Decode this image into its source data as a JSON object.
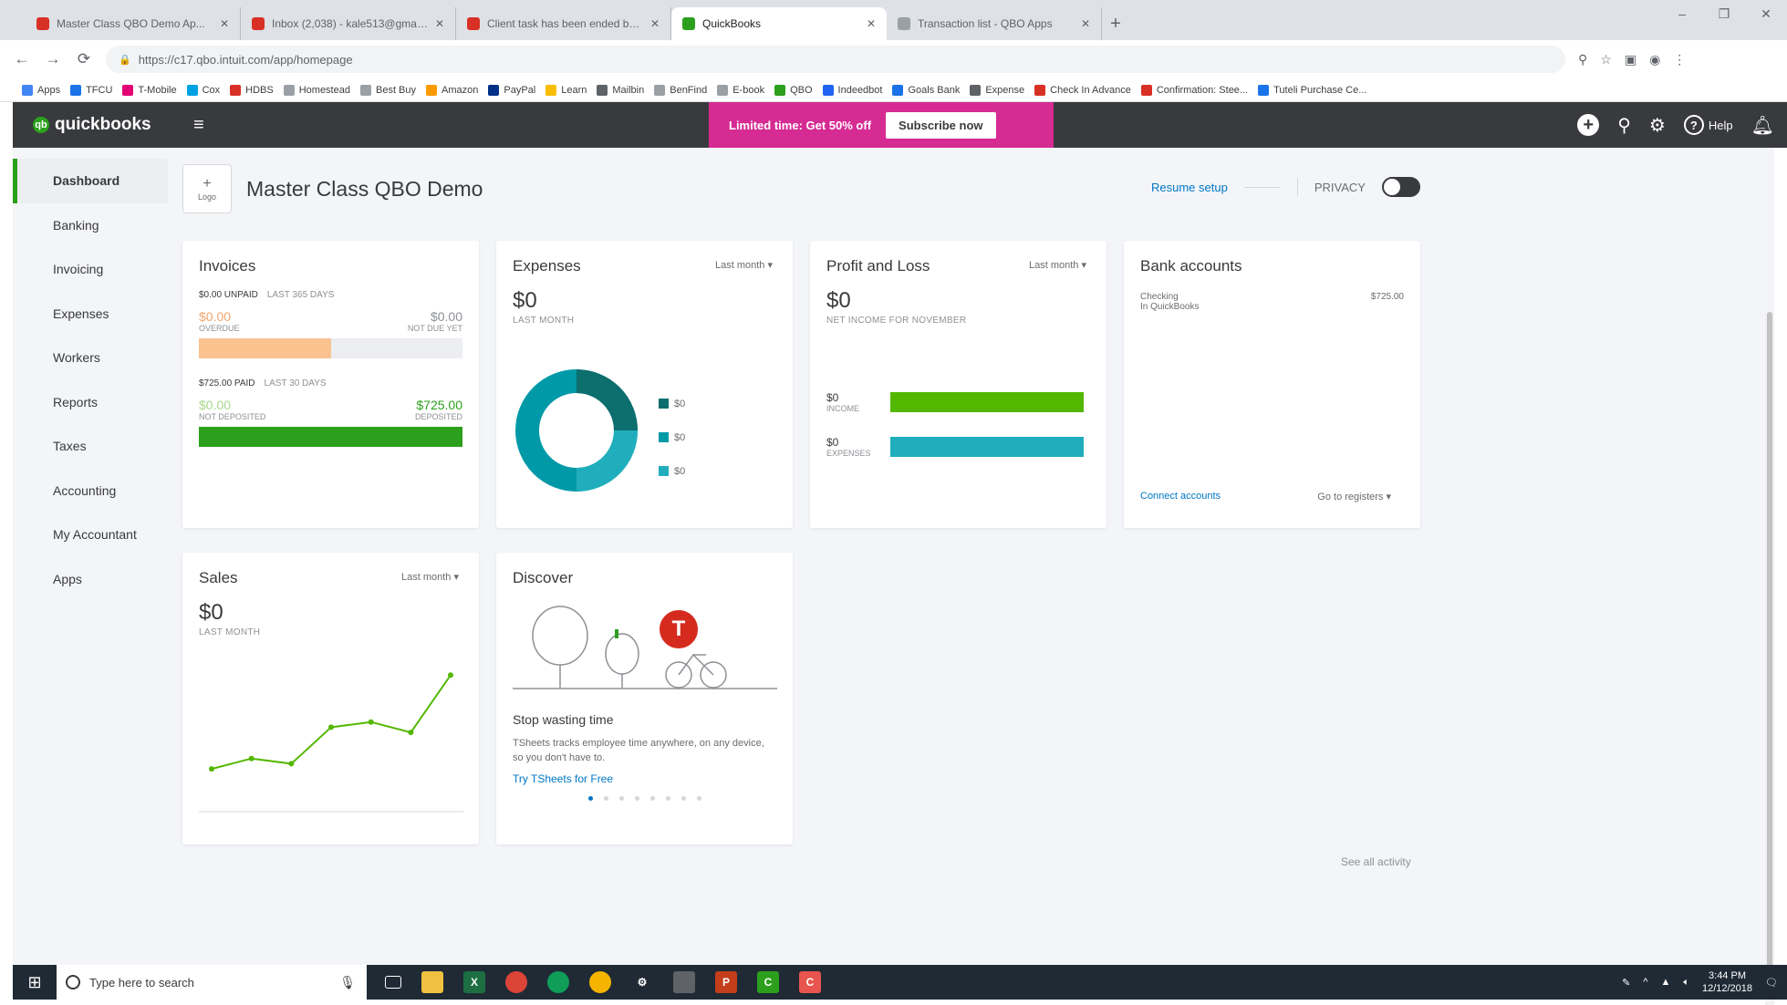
{
  "browser": {
    "tabs": [
      {
        "title": "Master Class QBO Demo Ap...",
        "icon": "gmail-icon",
        "color": "#d93025",
        "active": false
      },
      {
        "title": "Inbox (2,038) - kale513@gmail...",
        "icon": "gmail-icon",
        "color": "#d93025",
        "active": false
      },
      {
        "title": "Client task has been ended by ...",
        "icon": "gmail-icon",
        "color": "#d93025",
        "active": false
      },
      {
        "title": "QuickBooks",
        "icon": "quickbooks-icon",
        "color": "#2ca01c",
        "active": true
      },
      {
        "title": "Transaction list - QBO Apps",
        "icon": "page-icon",
        "color": "#9aa0a6",
        "active": false
      }
    ],
    "url": "https://c17.qbo.intuit.com/app/homepage",
    "bookmarks": [
      {
        "label": "Apps",
        "color": "#4285f4"
      },
      {
        "label": "TFCU",
        "color": "#1a73e8"
      },
      {
        "label": "T-Mobile",
        "color": "#e20074"
      },
      {
        "label": "Cox",
        "color": "#00a1e4"
      },
      {
        "label": "HDBS",
        "color": "#d93025"
      },
      {
        "label": "Homestead",
        "color": "#9aa0a6"
      },
      {
        "label": "Best Buy",
        "color": "#9aa0a6"
      },
      {
        "label": "Amazon",
        "color": "#ff9900"
      },
      {
        "label": "PayPal",
        "color": "#003087"
      },
      {
        "label": "Learn",
        "color": "#fbbc04"
      },
      {
        "label": "Mailbin",
        "color": "#5f6368"
      },
      {
        "label": "BenFind",
        "color": "#9aa0a6"
      },
      {
        "label": "E-book",
        "color": "#9aa0a6"
      },
      {
        "label": "QBO",
        "color": "#2ca01c"
      },
      {
        "label": "Indeedbot",
        "color": "#2164f3"
      },
      {
        "label": "Goals Bank",
        "color": "#1a73e8"
      },
      {
        "label": "Expense",
        "color": "#5f6368"
      },
      {
        "label": "Check In Advance",
        "color": "#d93025"
      },
      {
        "label": "Confirmation: Stee...",
        "color": "#d93025"
      },
      {
        "label": "Tuteli Purchase Ce...",
        "color": "#1a73e8"
      }
    ]
  },
  "header": {
    "logo": "quickbooks",
    "promo_text": "Limited time: Get 50% off",
    "promo_button": "Subscribe now",
    "help_label": "Help"
  },
  "sidebar": {
    "items": [
      "Dashboard",
      "Banking",
      "Invoicing",
      "Expenses",
      "Workers",
      "Reports",
      "Taxes",
      "Accounting",
      "My Accountant",
      "Apps"
    ]
  },
  "company": {
    "logo_label": "Logo",
    "name": "Master Class QBO Demo",
    "resume_setup": "Resume setup",
    "privacy": "PRIVACY"
  },
  "invoices": {
    "title": "Invoices",
    "unpaid_label": "$0.00 UNPAID",
    "unpaid_period": "LAST 365 DAYS",
    "overdue_amount": "$0.00",
    "overdue_label": "OVERDUE",
    "notdue_amount": "$0.00",
    "notdue_label": "NOT DUE YET",
    "unpaid_fill": 0.5,
    "paid_label": "$725.00 PAID",
    "paid_period": "LAST 30 DAYS",
    "notdeposited_amount": "$0.00",
    "notdeposited_label": "NOT DEPOSITED",
    "deposited_amount": "$725.00",
    "deposited_label": "DEPOSITED",
    "paid_fill": 1.0
  },
  "expenses": {
    "title": "Expenses",
    "period": "Last month",
    "amount": "$0",
    "sub": "LAST MONTH",
    "legend": [
      "$0",
      "$0",
      "$0"
    ],
    "colors": [
      "#0d6e6e",
      "#0099a8",
      "#21aebc"
    ]
  },
  "profit_loss": {
    "title": "Profit and Loss",
    "period": "Last month",
    "amount": "$0",
    "sub": "NET INCOME FOR NOVEMBER",
    "income_amount": "$0",
    "income_label": "INCOME",
    "expenses_amount": "$0",
    "expenses_label": "EXPENSES",
    "income_color": "#53b700",
    "expenses_color": "#21aebc"
  },
  "bank": {
    "title": "Bank accounts",
    "account": "Checking",
    "account_sub": "In QuickBooks",
    "balance": "$725.00",
    "connect": "Connect accounts",
    "goto": "Go to registers"
  },
  "sales": {
    "title": "Sales",
    "period": "Last month",
    "amount": "$0",
    "sub": "LAST MONTH",
    "line_values": [
      2,
      3,
      2.5,
      6,
      6.5,
      5.5,
      11
    ],
    "line_color": "#53b700"
  },
  "discover": {
    "title": "Discover",
    "headline": "Stop wasting time",
    "body": "TSheets tracks employee time anywhere, on any device, so you don't have to.",
    "link": "Try TSheets for Free",
    "badge": "T",
    "dots": 8,
    "active_dot": 0
  },
  "see_all_activity": "See all activity",
  "taskbar": {
    "search_placeholder": "Type here to search",
    "time": "3:44 PM",
    "date": "12/12/2018"
  }
}
